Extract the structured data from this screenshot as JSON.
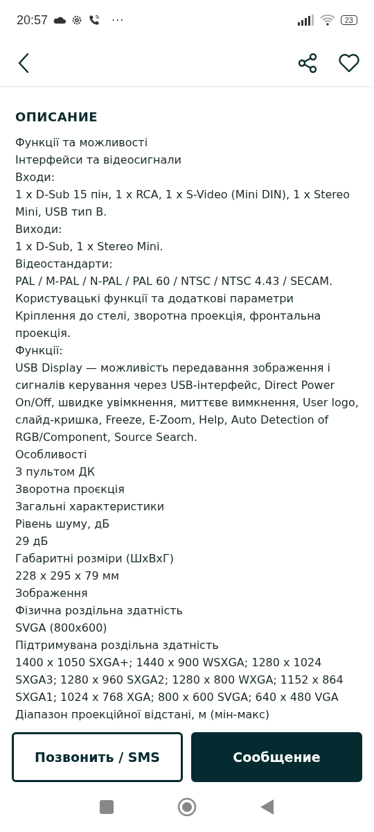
{
  "status_bar": {
    "time": "20:57",
    "more": "···",
    "battery": "23"
  },
  "header": {
    "title": "ОПИСАНИЕ"
  },
  "description": [
    "Функції та можливості",
    "Інтерфейси та відеосигнали",
    "Входи:",
    "1 x D-Sub 15 пін, 1 x RCA, 1 x S-Video (Mini DIN), 1 x Stereo Mini, USB тип B.",
    "Виходи:",
    "1 x D-Sub, 1 x Stereo Mini.",
    "Відеостандарти:",
    "PAL / M-PAL / N-PAL / PAL 60 / NTSC / NTSC 4.43 / SECAM.",
    "Користувацькі функції та додаткові параметри",
    "Кріплення до стелі, зворотна проекція, фронтальна проекція.",
    "Функції:",
    "USB Display — можливість передавання зображення і сигналів керування через USB-інтерфейс, Direct Power On/Off, швидке увімкнення, миттєве вимкнення, User logo, слайд-кришка, Freeze, E-Zoom, Help, Auto Detection of RGB/Component, Source Search.",
    "Особливості",
    "З пультом ДК",
    "Зворотна проєкція",
    "Загальні характеристики",
    "Рівень шуму, дБ",
    "29 дБ",
    "Габаритні розміри (ШхВхГ)",
    "228 x 295 x 79 мм",
    "Зображення",
    "Фізична роздільна здатність",
    "SVGA (800x600)",
    "Підтримувана роздільна здатність",
    "1400 x 1050 SXGA+; 1440 x 900 WSXGA; 1280 x 1024 SXGA3; 1280 x 960 SXGA2; 1280 x 800 WXGA; 1152 x 864 SXGA1; 1024 x 768 XGA; 800 x 600 SVGA; 640 x 480 VGA",
    "Діапазон проекційної відстані, м (мін-макс)"
  ],
  "actions": [
    {
      "label": "Позвонить / SMS",
      "kind": "outline"
    },
    {
      "label": "Сообщение",
      "kind": "filled"
    }
  ]
}
